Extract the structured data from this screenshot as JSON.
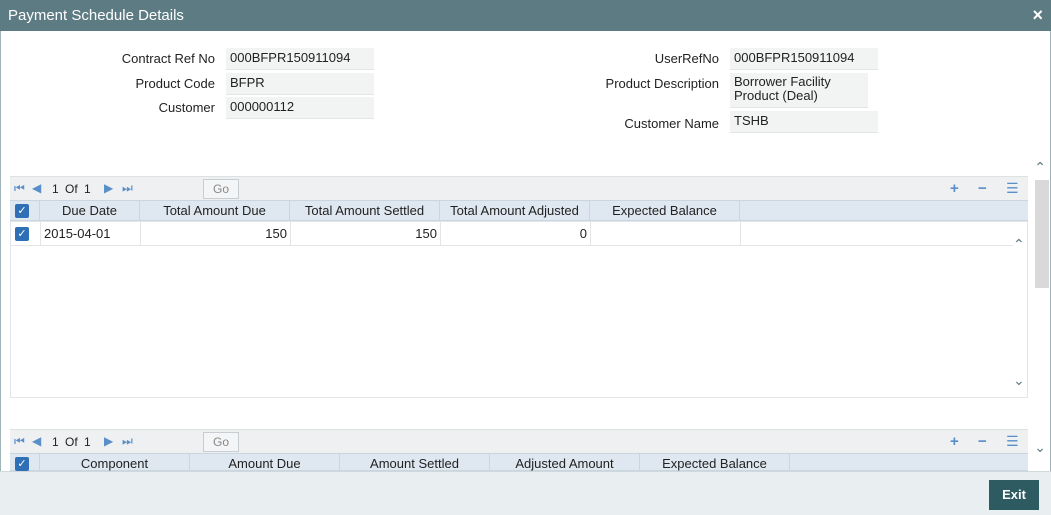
{
  "window": {
    "title": "Payment Schedule Details",
    "close_icon": "×"
  },
  "form": {
    "contract_ref_label": "Contract Ref No",
    "contract_ref_value": "000BFPR150911094",
    "product_code_label": "Product Code",
    "product_code_value": "BFPR",
    "customer_label": "Customer",
    "customer_value": "000000112",
    "user_ref_label": "UserRefNo",
    "user_ref_value": "000BFPR150911094",
    "product_desc_label": "Product Description",
    "product_desc_line1": "Borrower Facility",
    "product_desc_line2": "Product (Deal)",
    "customer_name_label": "Customer Name",
    "customer_name_value": "TSHB"
  },
  "schedule_grid": {
    "pager": {
      "current": "1",
      "of_label": "Of",
      "total": "1",
      "go_label": "Go"
    },
    "columns": [
      "Due Date",
      "Total Amount Due",
      "Total Amount Settled",
      "Total Amount Adjusted",
      "Expected Balance"
    ],
    "rows": [
      {
        "due_date": "2015-04-01",
        "total_due": "150",
        "total_settled": "150",
        "total_adjusted": "0",
        "expected_balance": ""
      }
    ]
  },
  "component_grid": {
    "pager": {
      "current": "1",
      "of_label": "Of",
      "total": "1",
      "go_label": "Go"
    },
    "columns": [
      "Component",
      "Amount Due",
      "Amount Settled",
      "Adjusted Amount",
      "Expected Balance"
    ]
  },
  "footer": {
    "exit_label": "Exit"
  },
  "icons": {
    "first": "first-page-icon",
    "prev": "prev-page-icon",
    "next": "next-page-icon",
    "last": "last-page-icon",
    "add": "add-row-icon",
    "delete": "delete-row-icon",
    "view": "single-view-icon"
  },
  "colors": {
    "titlebar": "#5d7b82",
    "accent": "#2f6fb5",
    "exit_button": "#2e5b62"
  }
}
